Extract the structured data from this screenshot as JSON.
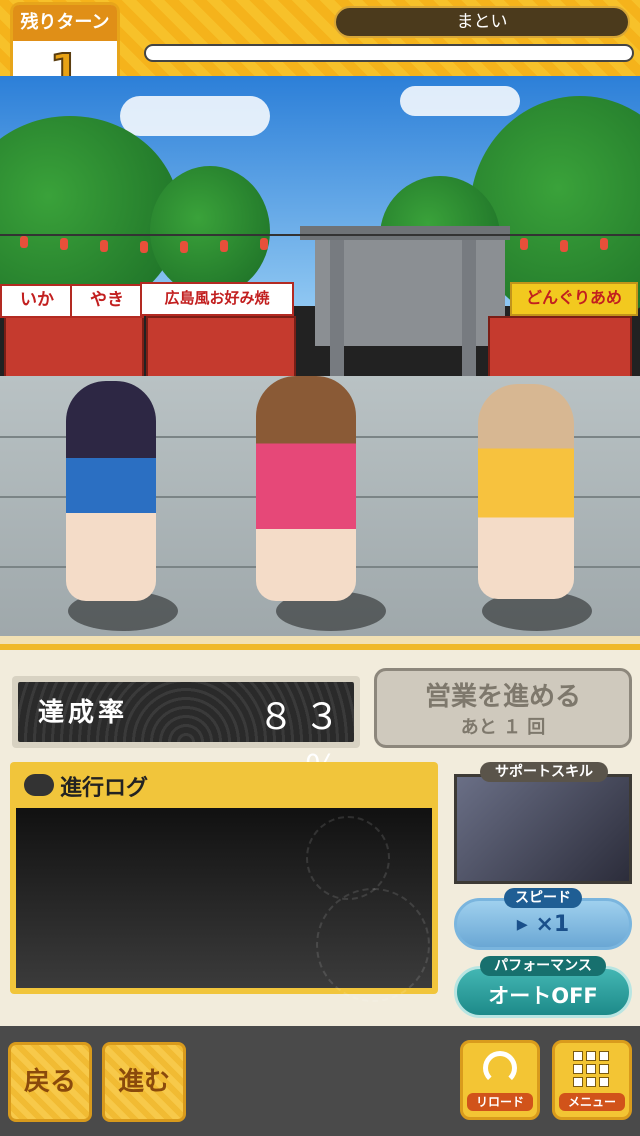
{
  "header": {
    "turns_label": "残りターン",
    "turns_value": "1",
    "unit_name": "まとい",
    "progress_fraction": 0
  },
  "scene": {
    "stalls": [
      "いか",
      "やき",
      "広島風お好み焼",
      "どんぐりあめ"
    ]
  },
  "status": {
    "rate_label": "達成率",
    "rate_value": "８３ ％",
    "advance_title": "営業を進める",
    "advance_sub": "あと １ 回"
  },
  "log": {
    "title": "進行ログ"
  },
  "side": {
    "support_label": "サポートスキル",
    "speed_label": "スピード",
    "speed_value": "▸ ×1",
    "performance_label": "パフォーマンス",
    "performance_value": "オートOFF"
  },
  "footer": {
    "back_label": "戻る",
    "forward_label": "進む",
    "reload_label": "リロード",
    "menu_label": "メニュー"
  }
}
